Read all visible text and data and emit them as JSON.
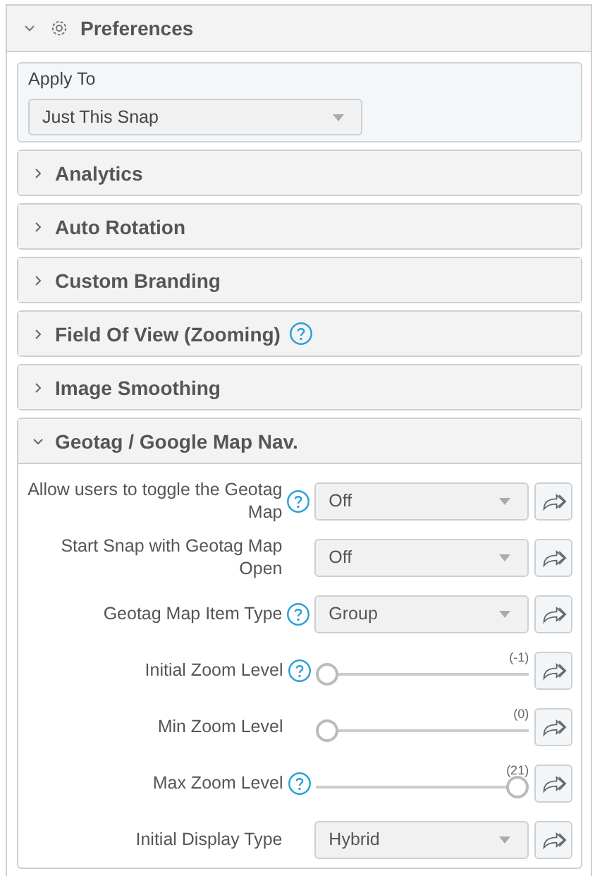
{
  "panel": {
    "title": "Preferences",
    "expanded": true
  },
  "apply_to": {
    "label": "Apply To",
    "value": "Just This Snap"
  },
  "sections": [
    {
      "title": "Analytics",
      "expanded": false,
      "help": false
    },
    {
      "title": "Auto Rotation",
      "expanded": false,
      "help": false
    },
    {
      "title": "Custom Branding",
      "expanded": false,
      "help": false
    },
    {
      "title": "Field Of View (Zooming)",
      "expanded": false,
      "help": true
    },
    {
      "title": "Image Smoothing",
      "expanded": false,
      "help": false
    },
    {
      "title": "Geotag / Google Map Nav.",
      "expanded": true,
      "help": false,
      "fields": [
        {
          "kind": "select",
          "label": "Allow users to toggle the Geotag Map",
          "help": true,
          "value": "Off"
        },
        {
          "kind": "select",
          "label": "Start Snap with Geotag Map Open",
          "help": false,
          "value": "Off"
        },
        {
          "kind": "select",
          "label": "Geotag Map Item Type",
          "help": true,
          "value": "Group"
        },
        {
          "kind": "slider",
          "label": "Initial Zoom Level",
          "help": true,
          "level": 0,
          "reading": "(-1)"
        },
        {
          "kind": "slider",
          "label": "Min Zoom Level",
          "help": false,
          "level": 0,
          "reading": "(0)"
        },
        {
          "kind": "slider",
          "label": "Max Zoom Level",
          "help": true,
          "level": 1,
          "reading": "(21)"
        },
        {
          "kind": "select",
          "label": "Initial Display Type",
          "help": false,
          "value": "Hybrid"
        }
      ]
    }
  ]
}
